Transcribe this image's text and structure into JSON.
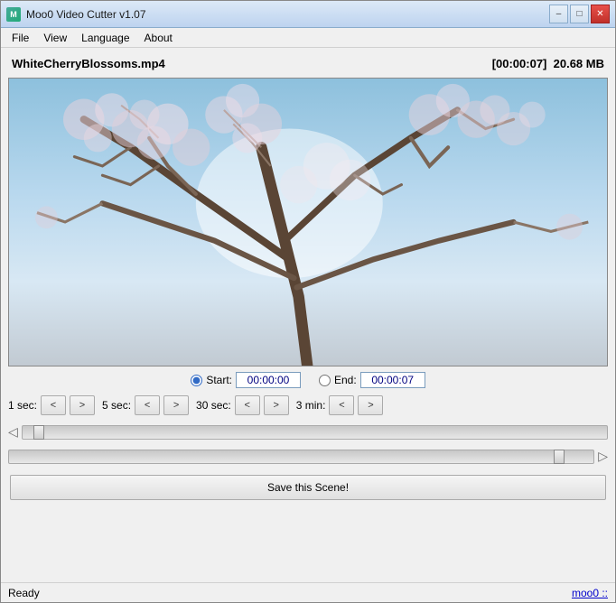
{
  "titleBar": {
    "appName": "Moo0 Video Cutter v1.07",
    "iconLabel": "M",
    "minimizeLabel": "–",
    "maximizeLabel": "□",
    "closeLabel": "✕"
  },
  "menuBar": {
    "items": [
      {
        "id": "file",
        "label": "File"
      },
      {
        "id": "view",
        "label": "View"
      },
      {
        "id": "language",
        "label": "Language"
      },
      {
        "id": "about",
        "label": "About"
      }
    ]
  },
  "fileInfo": {
    "fileName": "WhiteCherryBlossoms.mp4",
    "duration": "[00:00:07]",
    "fileSize": "20.68 MB"
  },
  "controls": {
    "startLabel": "Start:",
    "startValue": "00:00:00",
    "endLabel": "End:",
    "endValue": "00:00:07",
    "steps": [
      {
        "id": "1sec",
        "label": "1 sec:"
      },
      {
        "id": "5sec",
        "label": "5 sec:"
      },
      {
        "id": "30sec",
        "label": "30 sec:"
      },
      {
        "id": "3min",
        "label": "3 min:"
      }
    ],
    "prevLabel": "<",
    "nextLabel": ">",
    "saveButton": "Save this Scene!"
  },
  "statusBar": {
    "statusText": "Ready",
    "linkText": "moo0 ::"
  }
}
